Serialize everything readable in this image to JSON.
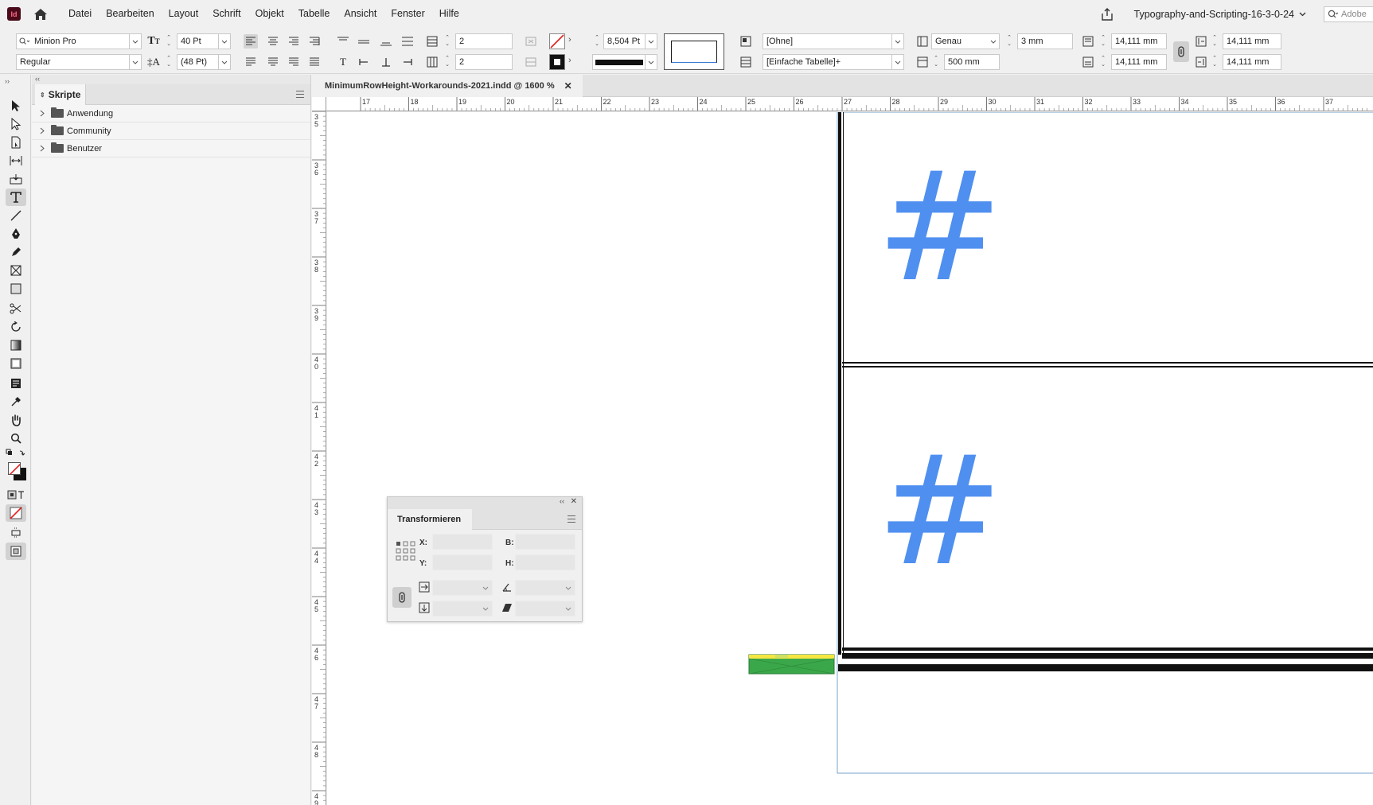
{
  "app": {
    "icon_label": "Id"
  },
  "menu": [
    "Datei",
    "Bearbeiten",
    "Layout",
    "Schrift",
    "Objekt",
    "Tabelle",
    "Ansicht",
    "Fenster",
    "Hilfe"
  ],
  "workspace_name": "Typography-and-Scripting-16-3-0-24",
  "adobe_search_placeholder": "Adobe",
  "control": {
    "font_family": "Minion Pro",
    "font_style": "Regular",
    "font_size": "40 Pt",
    "leading": "(48 Pt)",
    "rows": "2",
    "columns": "2",
    "stroke_weight": "8,504 Pt",
    "cell_style": "[Ohne]",
    "table_style": "[Einfache Tabelle]+",
    "row_height_mode": "Genau",
    "row_height": "3 mm",
    "max_height": "500 mm",
    "inset_top": "14,111 mm",
    "inset_bottom": "14,111 mm",
    "inset_left": "14,111 mm",
    "inset_right": "14,111 mm"
  },
  "scripts_panel": {
    "title": "Skripte",
    "items": [
      "Anwendung",
      "Community",
      "Benutzer"
    ]
  },
  "document": {
    "tab_title": "MinimumRowHeight-Workarounds-2021.indd @ 1600 %",
    "h_ruler": [
      "17",
      "18",
      "19",
      "20",
      "21",
      "22",
      "23",
      "24",
      "25",
      "26",
      "27",
      "28",
      "29",
      "30",
      "31",
      "32",
      "33",
      "34",
      "35",
      "36",
      "37"
    ],
    "v_ruler": [
      "35",
      "36",
      "37",
      "38",
      "39",
      "40",
      "41",
      "42",
      "43",
      "44",
      "45",
      "46",
      "47",
      "48",
      "49"
    ],
    "cell_glyph": "#"
  },
  "transform_panel": {
    "title": "Transformieren",
    "x_label": "X:",
    "y_label": "Y:",
    "w_label": "B:",
    "h_label": "H:"
  },
  "colors": {
    "glyph": "#4f8ff0",
    "frame_green": "#3aa84a",
    "frame_yellow": "#f5e642"
  }
}
